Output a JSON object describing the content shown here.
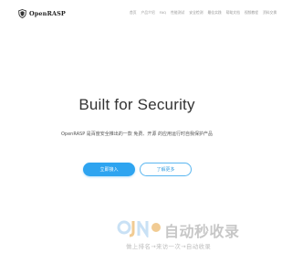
{
  "header": {
    "brand": "OpenRASP",
    "nav": [
      "首页",
      "产品介绍",
      "FAQ",
      "性能测试",
      "安全检测",
      "最佳实践",
      "帮助文档",
      "视频教程",
      "资料交换"
    ]
  },
  "hero": {
    "title": "Built for Security",
    "subtitle": "OpenRASP 是百度安全推出的一款 免费、开源 的应用运行时自我保护产品",
    "primary_button": "立即接入",
    "secondary_button": "了解更多"
  },
  "watermark": {
    "title": "自动秒收录",
    "slogan": "做上排名→来访一次→自动收录"
  },
  "colors": {
    "accent": "#2ea4f0",
    "text": "#333333",
    "nav_text": "#999999"
  }
}
